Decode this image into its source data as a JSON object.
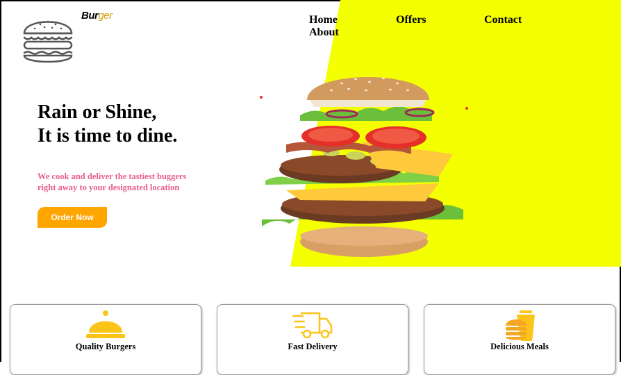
{
  "brand": {
    "name_part1": "Bur",
    "name_part2": "ger"
  },
  "nav": {
    "home": "Home",
    "offers": "Offers",
    "contact": "Contact",
    "about": "About"
  },
  "hero": {
    "headline_line1": "Rain or Shine,",
    "headline_line2": "It is time to dine.",
    "subtext": "We cook and deliver the tastiest buggers right away to your designated location",
    "order_button": "Order Now"
  },
  "features": [
    {
      "label": "Quality Burgers",
      "icon": "cloche-icon"
    },
    {
      "label": "Fast Delivery",
      "icon": "delivery-truck-icon"
    },
    {
      "label": "Delicious Meals",
      "icon": "burger-drink-icon"
    }
  ],
  "colors": {
    "accent_yellow": "#f4ff00",
    "button_orange": "#ffa500",
    "subtext_pink": "#e85d8a",
    "icon_gold": "#fcc419"
  }
}
